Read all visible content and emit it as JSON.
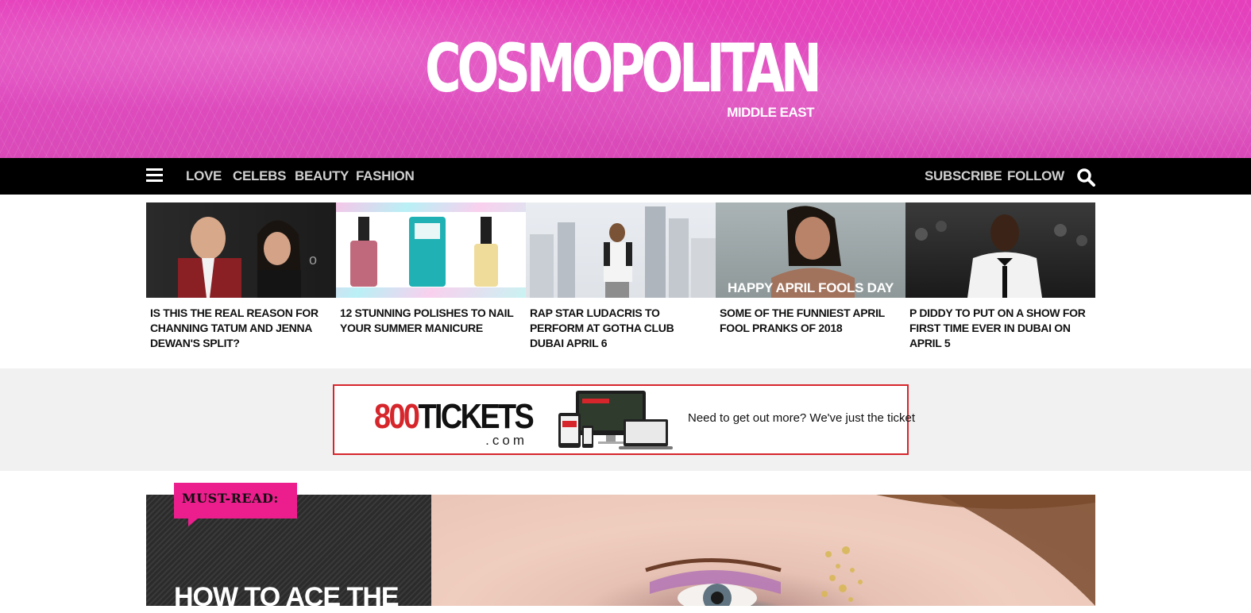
{
  "brand": {
    "name": "COSMOPOLITAN",
    "region": "MIDDLE EAST"
  },
  "nav": {
    "left_links": [
      "LOVE",
      "CELEBS",
      "BEAUTY",
      "FASHION"
    ],
    "right_links": [
      "SUBSCRIBE",
      "FOLLOW"
    ]
  },
  "stories": [
    {
      "title": "IS THIS THE REAL REASON FOR CHANNING TATUM AND JENNA DEWAN'S SPLIT?"
    },
    {
      "title": "12 STUNNING POLISHES TO NAIL YOUR SUMMER MANICURE"
    },
    {
      "title": "RAP STAR LUDACRIS TO PERFORM AT GOTHA CLUB DUBAI APRIL 6"
    },
    {
      "title": "SOME OF THE FUNNIEST APRIL FOOL PRANKS OF 2018",
      "image_caption": "HAPPY APRIL FOOLS DAY"
    },
    {
      "title": "P DIDDY TO PUT ON A SHOW FOR FIRST TIME EVER IN DUBAI ON APRIL 5"
    }
  ],
  "ad": {
    "logo_number": "800",
    "logo_word": "TICKETS",
    "logo_domain": ".com",
    "tagline": "Need to get out more? We've just the ticket"
  },
  "feature": {
    "badge": "MUST-READ:",
    "headline": "HOW TO ACE THE"
  },
  "colors": {
    "hero_pink": "#e04bbf",
    "nav_bg": "#000000",
    "ad_border": "#d6262b",
    "badge_pink": "#ec1e8e"
  },
  "icons": [
    "hamburger-menu-icon",
    "search-icon"
  ]
}
